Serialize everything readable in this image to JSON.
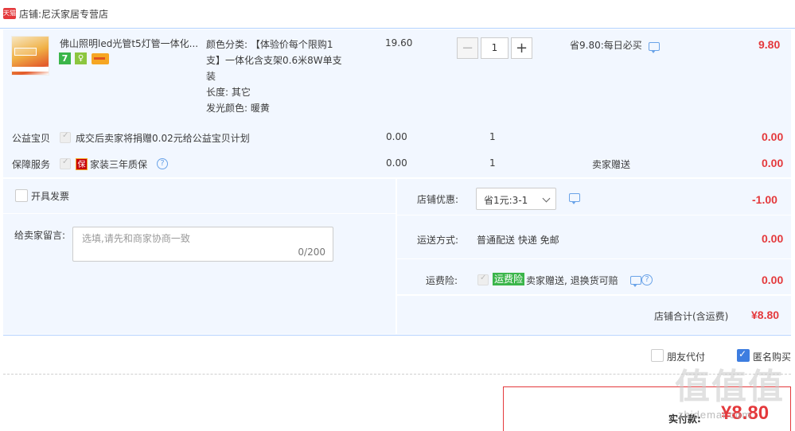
{
  "shop": {
    "label": "店铺:",
    "name": "尼沃家居专营店",
    "badge": "天猫"
  },
  "item": {
    "title": "佛山照明led光管t5灯管一体化...",
    "badge_seven": "7",
    "badge_guarantee": "♀",
    "spec_lines": [
      "颜色分类: 【体验价每个限购1",
      "支】一体化含支架0.6米8W单支",
      "装",
      "长度: 其它",
      "发光颜色: 暖黄"
    ],
    "unit_price": "19.60",
    "quantity": "1",
    "minus": "−",
    "plus": "+",
    "discount": "省9.80:每日必买",
    "subtotal": "9.80"
  },
  "charity": {
    "label": "公益宝贝",
    "text": "成交后卖家将捐赠0.02元给公益宝贝计划",
    "price": "0.00",
    "qty": "1",
    "subtotal": "0.00"
  },
  "service": {
    "label": "保障服务",
    "icon_text": "保",
    "text": "家装三年质保",
    "price": "0.00",
    "qty": "1",
    "note": "卖家赠送",
    "subtotal": "0.00",
    "help": "?"
  },
  "invoice": {
    "label": "开具发票"
  },
  "message": {
    "label": "给卖家留言:",
    "placeholder": "选填,请先和商家协商一致",
    "counter": "0/200"
  },
  "shop_discount": {
    "label": "店铺优惠:",
    "selected": "省1元:3-1",
    "amount": "-1.00"
  },
  "shipping": {
    "label": "运送方式:",
    "value": "普通配送 快递 免邮",
    "amount": "0.00"
  },
  "insurance": {
    "label": "运费险:",
    "tag": "运费险",
    "text": "卖家赠送, 退换货可赔",
    "amount": "0.00",
    "help": "?"
  },
  "shop_total": {
    "label": "店铺合计(含运费)",
    "amount": "¥8.80"
  },
  "options": {
    "friend_pay": "朋友代付",
    "anonymous": "匿名购买"
  },
  "pay": {
    "label": "实付款:",
    "amount": "¥8.80"
  },
  "watermark": {
    "main": "值值值",
    "sub": "zhidemai.com"
  },
  "colors": {
    "accent": "#3d7de0",
    "price": "#e4393c",
    "panel": "#f2f7ff",
    "border": "#b2d1ff"
  }
}
